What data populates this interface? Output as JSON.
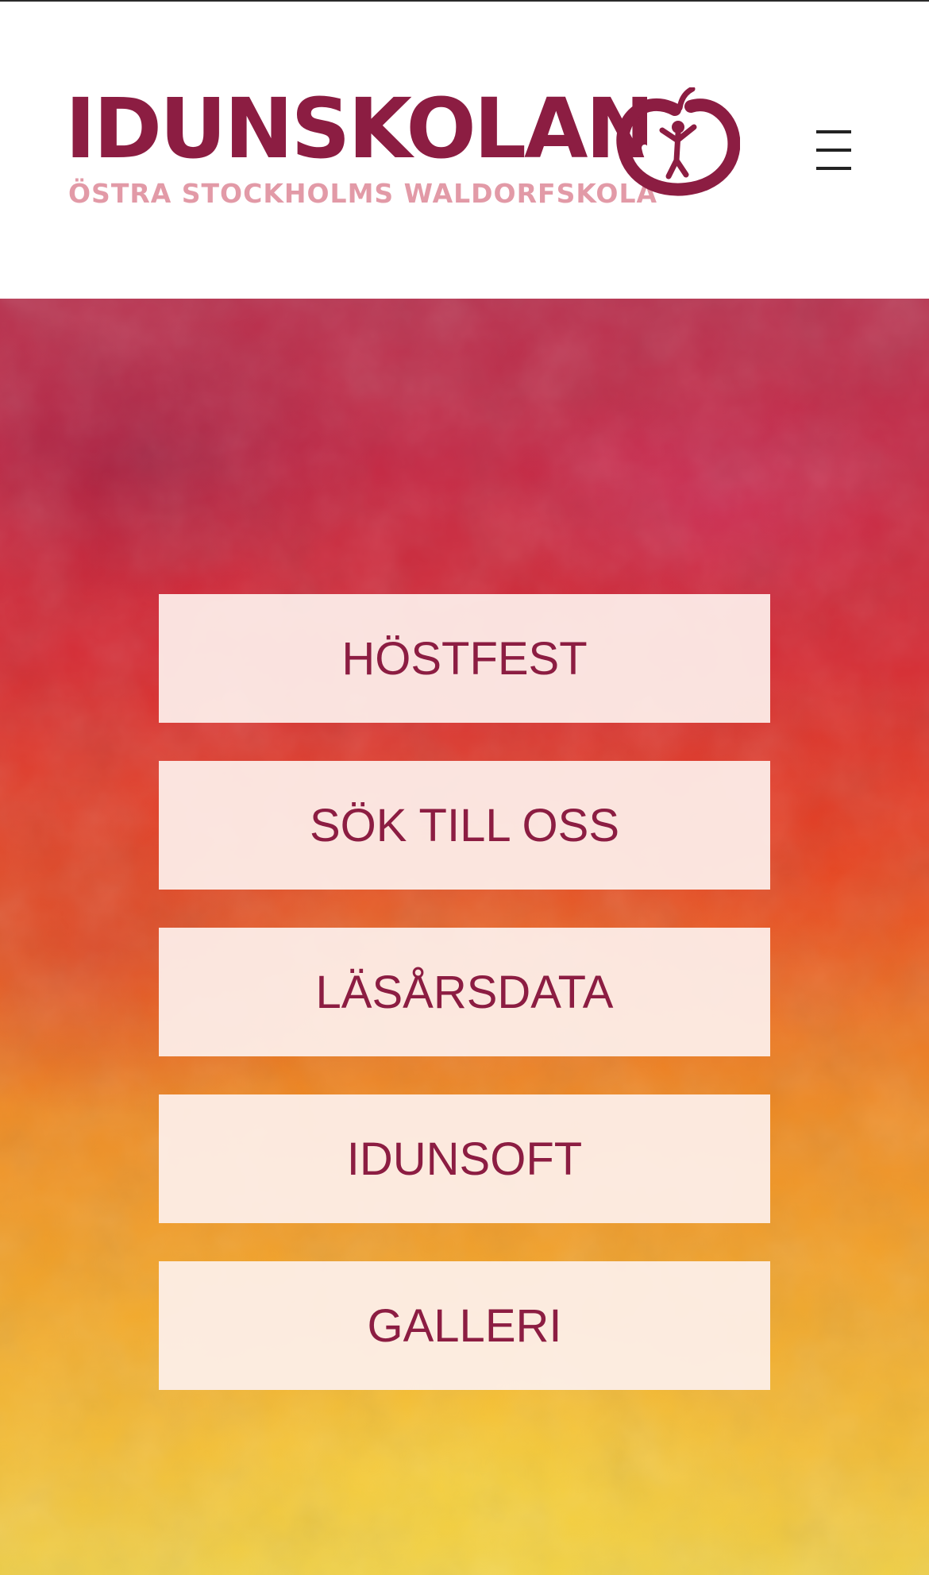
{
  "header": {
    "logo_title": "IDUNSKOLAN",
    "logo_subtitle": "ÖSTRA STOCKHOLMS WALDORFSKOLA",
    "logo_mark_icon": "apple-figure-icon",
    "menu_icon": "hamburger-menu-icon"
  },
  "colors": {
    "brand": "#8c1d42",
    "subtitle": "#e29aa7",
    "button_bg": "#fdf0ec"
  },
  "nav": {
    "buttons": [
      {
        "label": "HÖSTFEST"
      },
      {
        "label": "SÖK TILL OSS"
      },
      {
        "label": "LÄSÅRSDATA"
      },
      {
        "label": "IDUNSOFT"
      },
      {
        "label": "GALLERI"
      }
    ]
  }
}
